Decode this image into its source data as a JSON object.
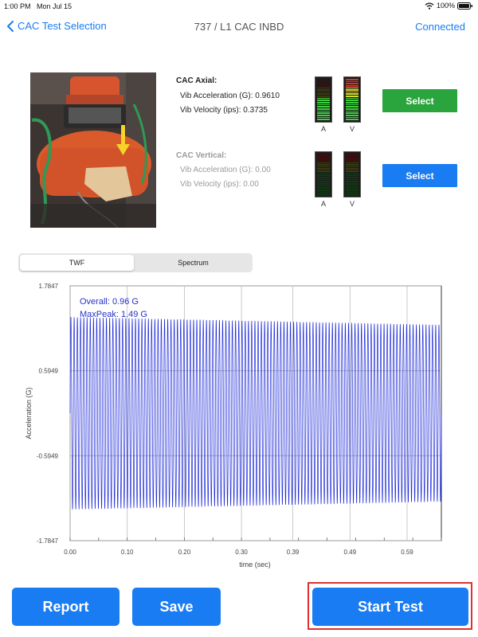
{
  "status_bar": {
    "time": "1:00 PM",
    "date": "Mon Jul 15",
    "battery": "100%"
  },
  "nav": {
    "back_label": "CAC Test Selection",
    "title": "737 / L1 CAC INBD",
    "connection": "Connected"
  },
  "sensors": [
    {
      "title": "CAC Axial:",
      "accel_line": "Vib Acceleration (G): 0.9610",
      "vel_line": "Vib Velocity (ips): 0.3735",
      "meter_a_level": 0.55,
      "meter_v_level": 1.0,
      "button": "Select",
      "button_color": "#2aa43c"
    },
    {
      "title": "CAC Vertical:",
      "accel_line": "Vib Acceleration (G): 0.00",
      "vel_line": "Vib Velocity (ips): 0.00",
      "meter_a_level": 0.0,
      "meter_v_level": 0.0,
      "button": "Select",
      "button_color": "#1a7cf2"
    }
  ],
  "meter_labels": {
    "a": "A",
    "v": "V"
  },
  "tabs": [
    {
      "label": "TWF",
      "selected": true
    },
    {
      "label": "Spectrum",
      "selected": false
    }
  ],
  "chart_data": {
    "type": "line",
    "title": "",
    "xlabel": "time (sec)",
    "ylabel": "Acceleration (G)",
    "ylim": [
      -1.7847,
      1.7847
    ],
    "xlim": [
      0.0,
      0.65
    ],
    "y_ticks": [
      "1.7847",
      "0.5949",
      "-0.5949",
      "-1.7847"
    ],
    "x_ticks": [
      "0.00",
      "0.10",
      "0.20",
      "0.30",
      "0.39",
      "0.49",
      "0.59"
    ],
    "annotations": [
      "Overall: 0.96 G",
      "MaxPeak: 1.49 G"
    ],
    "series": [
      {
        "waveform": "sine",
        "cycles": 115,
        "amplitude_start": 1.35,
        "amplitude_end": 1.24,
        "color": "#1f2bd8"
      }
    ]
  },
  "buttons": {
    "report": "Report",
    "save": "Save",
    "start": "Start Test"
  }
}
